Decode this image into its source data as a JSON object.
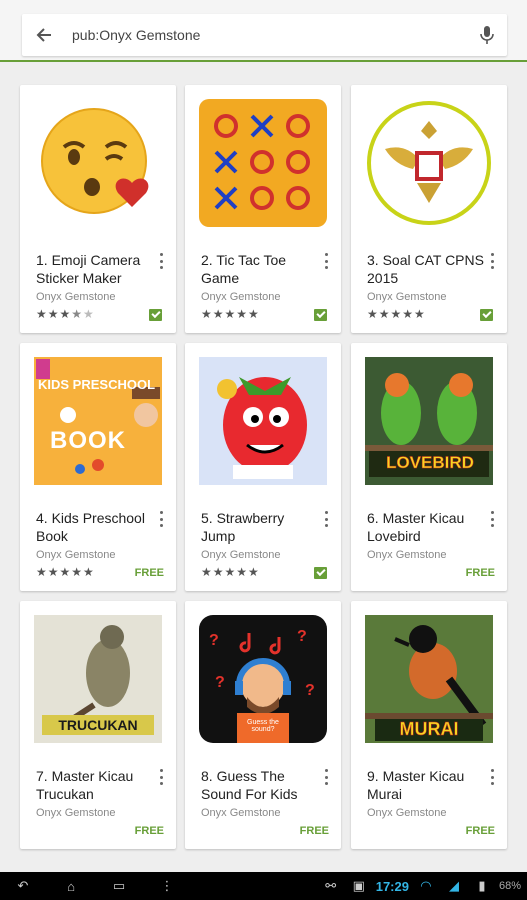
{
  "search": {
    "query": "pub:Onyx Gemstone"
  },
  "apps": [
    {
      "title": "1. Emoji Camera Sticker Maker",
      "developer": "Onyx Gemstone",
      "stars": 3.5,
      "price_icon": "installed-icon"
    },
    {
      "title": "2. Tic Tac Toe Game",
      "developer": "Onyx Gemstone",
      "stars": 5,
      "price_icon": "installed-icon"
    },
    {
      "title": "3. Soal CAT CPNS 2015",
      "developer": "Onyx Gemstone",
      "stars": 5,
      "price_icon": "installed-icon"
    },
    {
      "title": "4. Kids Preschool Book",
      "developer": "Onyx Gemstone",
      "stars": 5,
      "price": "FREE",
      "thumb_text": [
        "KIDS PRESCHOOL",
        "BOOK"
      ]
    },
    {
      "title": "5. Strawberry Jump",
      "developer": "Onyx Gemstone",
      "stars": 5,
      "price_icon": "installed-icon"
    },
    {
      "title": "6. Master Kicau Lovebird",
      "developer": "Onyx Gemstone",
      "price": "FREE",
      "thumb_text": "LOVEBIRD"
    },
    {
      "title": "7. Master Kicau Trucukan",
      "developer": "Onyx Gemstone",
      "price": "FREE",
      "thumb_text": "TRUCUKAN"
    },
    {
      "title": "8. Guess The Sound For Kids",
      "developer": "Onyx Gemstone",
      "price": "FREE",
      "thumb_text": "Guess the sound?"
    },
    {
      "title": "9. Master Kicau Murai",
      "developer": "Onyx Gemstone",
      "price": "FREE",
      "thumb_text": "MURAI"
    }
  ],
  "status": {
    "time": "17:29",
    "battery": "68%"
  },
  "colors": {
    "accent": "#689f38",
    "clock": "#33b5e5"
  }
}
